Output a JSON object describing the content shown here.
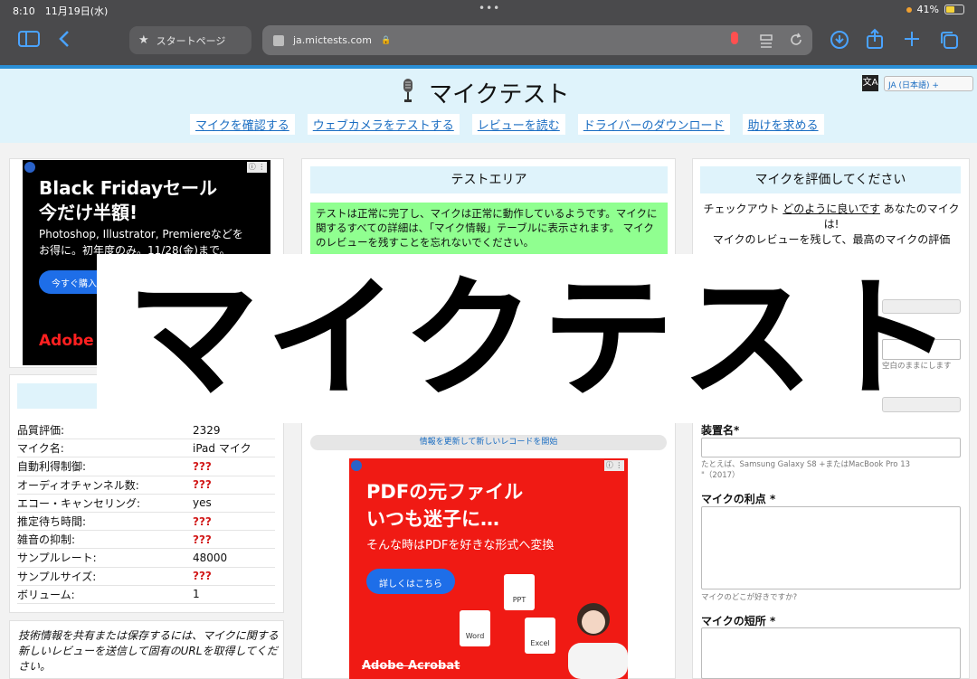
{
  "status": {
    "time_date": "8:10　11月19日(水)",
    "battery": "41%"
  },
  "browser": {
    "tab_label": "スタートページ",
    "url": "ja.mictests.com"
  },
  "header": {
    "title": "マイクテスト",
    "lang": "JA (日本語) +",
    "nav": [
      "マイクを確認する",
      "ウェブカメラをテストする",
      "レビューを読む",
      "ドライバーのダウンロード",
      "助けを求める"
    ]
  },
  "ad1": {
    "headline1": "Black Fridayセール",
    "headline2": "今だけ半額!",
    "sub1": "Photoshop, Illustrator, Premiereなどを",
    "sub2": "お得に。初年度のみ。11/28(金)まで。",
    "button": "今すぐ購入",
    "logo": "Adobe"
  },
  "info": {
    "rows": [
      {
        "k": "品質評価:",
        "v": "2329",
        "bad": false
      },
      {
        "k": "マイク名:",
        "v": "iPad マイク",
        "bad": false
      },
      {
        "k": "自動利得制御:",
        "v": "???",
        "bad": true
      },
      {
        "k": "オーディオチャンネル数:",
        "v": "???",
        "bad": true
      },
      {
        "k": "エコー・キャンセリング:",
        "v": "yes",
        "bad": false
      },
      {
        "k": "推定待ち時間:",
        "v": "???",
        "bad": true
      },
      {
        "k": "雑音の抑制:",
        "v": "???",
        "bad": true
      },
      {
        "k": "サンプルレート:",
        "v": "48000",
        "bad": false
      },
      {
        "k": "サンプルサイズ:",
        "v": "???",
        "bad": true
      },
      {
        "k": "ボリューム:",
        "v": "1",
        "bad": false
      }
    ],
    "share_text": "技術情報を共有または保存するには、マイクに関する新しいレビューを送信して固有のURLを取得してください。"
  },
  "test": {
    "title": "テストエリア",
    "ok_text": "テストは正常に完了し、マイクは正常に動作しているようです。マイクに関するすべての詳細は、「マイク情報」テーブルに表示されます。 マイクのレビューを残すことを忘れないでください。",
    "refresh": "情報を更新して新しいレコードを開始"
  },
  "ad2": {
    "headline1": "PDFの元ファイル",
    "headline2": "いつも迷子に…",
    "sub": "そんな時はPDFを好きな形式へ変換",
    "button": "詳しくはこちら",
    "logo": "Adobe Acrobat",
    "files": [
      "Word",
      "PPT",
      "Excel"
    ]
  },
  "rate": {
    "title": "マイクを評価してください",
    "text_pre": "チェックアウト ",
    "text_link": "どのように良いです",
    "text_post": " あなたのマイクは!",
    "text2": "マイクのレビューを残して、最高のマイクの評価",
    "empty_hint": "空白のままにします",
    "device_label": "装置名*",
    "device_hint": "たとえば、Samsung Galaxy S8 +またはMacBook Pro 13 \"（2017）",
    "pros_label": "マイクの利点 *",
    "pros_hint": "マイクのどこが好きですか?",
    "cons_label": "マイクの短所 *"
  },
  "overlay": {
    "text": "マイクテスト"
  }
}
